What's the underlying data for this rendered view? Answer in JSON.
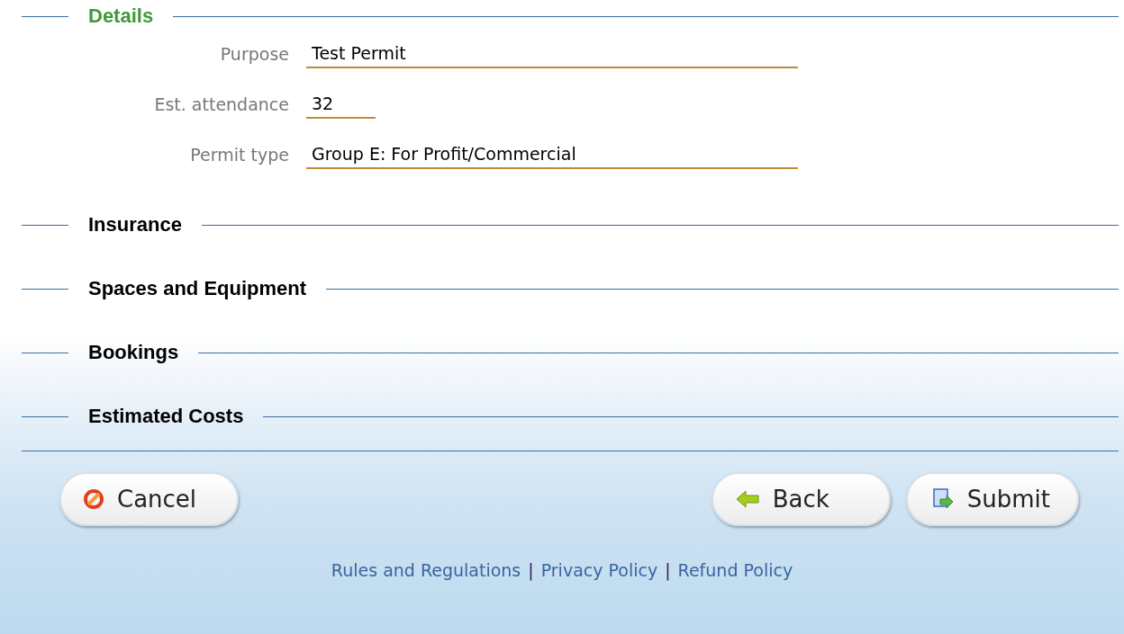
{
  "sections": [
    {
      "title": "Details",
      "expanded": true,
      "fields": [
        {
          "label": "Purpose",
          "value": "Test Permit",
          "kind": "wide"
        },
        {
          "label": "Est. attendance",
          "value": "32",
          "kind": "short"
        },
        {
          "label": "Permit type",
          "value": "Group E: For Profit/Commercial",
          "kind": "wide"
        }
      ]
    },
    {
      "title": "Insurance",
      "expanded": false
    },
    {
      "title": "Spaces and Equipment",
      "expanded": false
    },
    {
      "title": "Bookings",
      "expanded": false
    },
    {
      "title": "Estimated Costs",
      "expanded": false
    }
  ],
  "buttons": [
    {
      "label": "Cancel",
      "kind": "cancel"
    },
    {
      "label": "Back",
      "kind": "back"
    },
    {
      "label": "Submit",
      "kind": "submit"
    }
  ],
  "footer": {
    "links": [
      "Rules and Regulations",
      "Privacy Policy",
      "Refund Policy"
    ],
    "separator": "|"
  }
}
